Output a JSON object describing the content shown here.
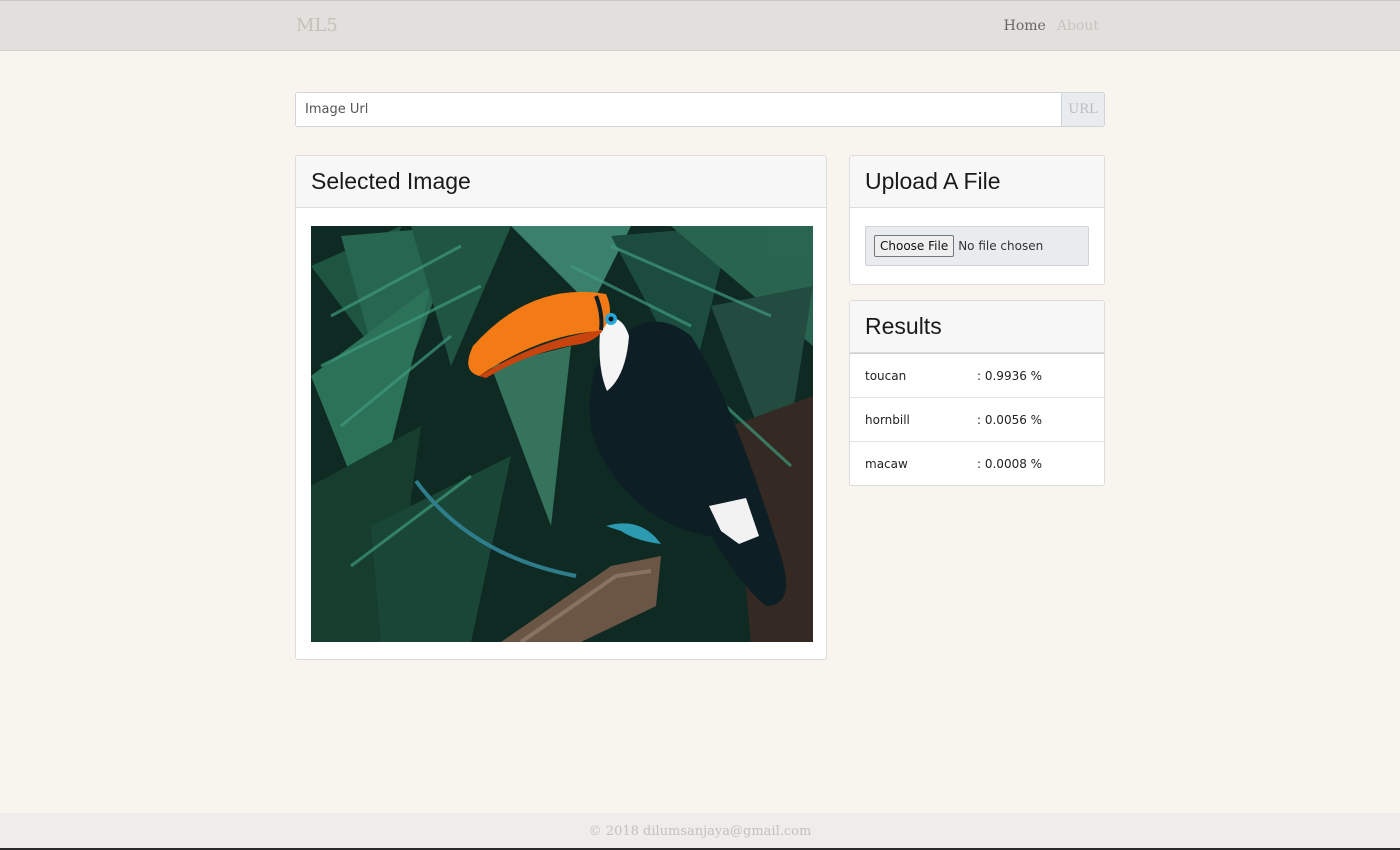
{
  "navbar": {
    "brand": "ML5",
    "links": [
      {
        "label": "Home",
        "active": true
      },
      {
        "label": "About",
        "active": false
      }
    ]
  },
  "search": {
    "placeholder": "Image Url",
    "value": "",
    "button_label": "URL"
  },
  "selected_image": {
    "title": "Selected Image",
    "image_subject": "toucan perched on a branch among green palm leaves"
  },
  "upload": {
    "title": "Upload A File",
    "button_label": "Choose File",
    "status": "No file chosen"
  },
  "results": {
    "title": "Results",
    "rows": [
      {
        "label": "toucan",
        "value": ": 0.9936 %"
      },
      {
        "label": "hornbill",
        "value": ": 0.0056 %"
      },
      {
        "label": "macaw",
        "value": ": 0.0008 %"
      }
    ]
  },
  "footer": {
    "text": "© 2018 dilumsanjaya@gmail.com"
  },
  "colors": {
    "page_bg": "#f8f4ee",
    "navbar_bg": "#e2dfdc",
    "beak": "#f47a16",
    "foliage": "#1f5a45"
  }
}
